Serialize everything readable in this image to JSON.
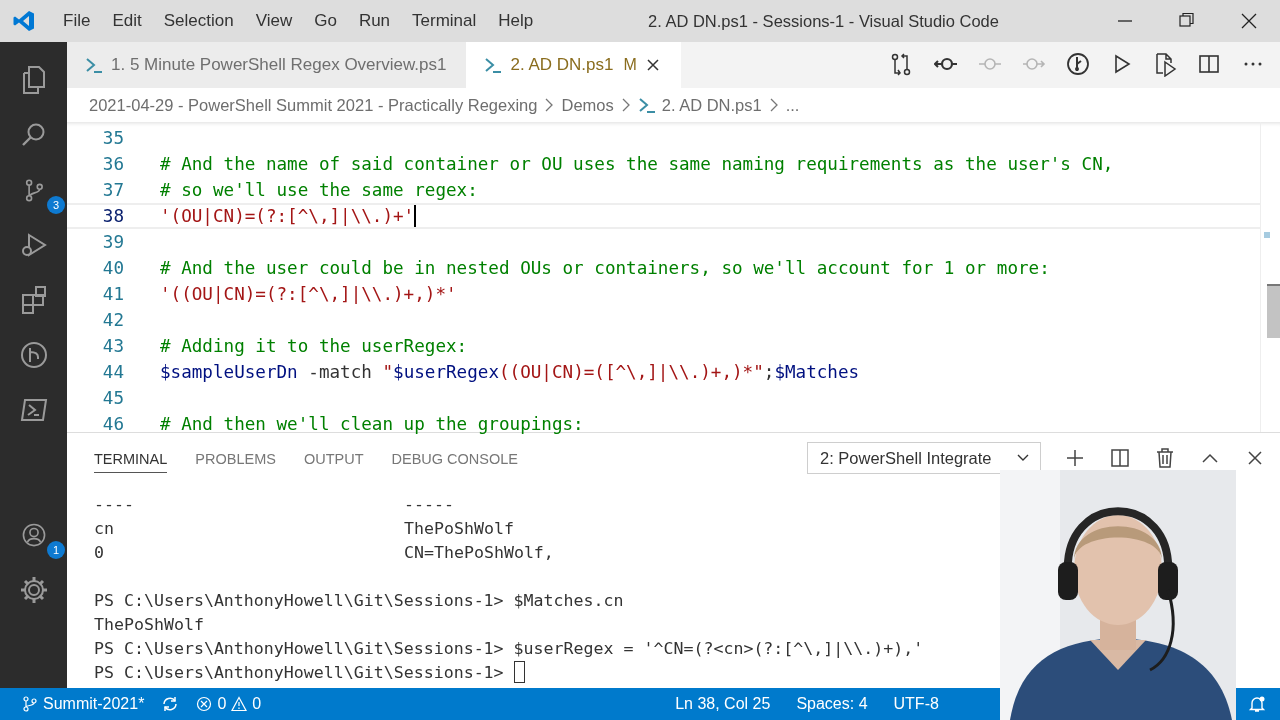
{
  "window": {
    "title": "2. AD DN.ps1 - Sessions-1 - Visual Studio Code"
  },
  "menu": [
    "File",
    "Edit",
    "Selection",
    "View",
    "Go",
    "Run",
    "Terminal",
    "Help"
  ],
  "activity_bar": [
    {
      "kind": "explorer"
    },
    {
      "kind": "search"
    },
    {
      "kind": "scm",
      "badge": "3"
    },
    {
      "kind": "debug"
    },
    {
      "kind": "extensions"
    },
    {
      "kind": "remote"
    },
    {
      "kind": "powershell"
    },
    {
      "kind": "account",
      "badge": "1"
    },
    {
      "kind": "settings"
    }
  ],
  "tabs": [
    {
      "label": "1. 5 Minute PowerShell Regex Overview.ps1",
      "selected": false,
      "modified": false
    },
    {
      "label": "2. AD DN.ps1",
      "selected": true,
      "modified": true,
      "mark": "M"
    }
  ],
  "editor_actions": [
    {
      "kind": "compare",
      "enabled": true
    },
    {
      "kind": "prev",
      "enabled": true
    },
    {
      "kind": "commit",
      "enabled": false
    },
    {
      "kind": "next",
      "enabled": false
    },
    {
      "kind": "timeline",
      "enabled": true
    },
    {
      "kind": "run",
      "enabled": true
    },
    {
      "kind": "runfile",
      "enabled": true
    },
    {
      "kind": "split",
      "enabled": true
    },
    {
      "kind": "more",
      "enabled": true
    }
  ],
  "breadcrumbs": [
    {
      "label": "2021-04-29 - PowerShell Summit 2021 - Practically Regexing"
    },
    {
      "label": "Demos"
    },
    {
      "label": "2. AD DN.ps1",
      "kind": "file"
    },
    {
      "label": "..."
    }
  ],
  "editor": {
    "lines": [
      {
        "number": "35"
      },
      {
        "number": "36",
        "tokens": [
          {
            "kind": "comment",
            "text": "# And the name of said container or OU uses the same naming requirements as the user's CN,"
          }
        ]
      },
      {
        "number": "37",
        "tokens": [
          {
            "kind": "comment",
            "text": "# so we'll use the same regex:"
          }
        ]
      },
      {
        "number": "38",
        "current": true,
        "tokens": [
          {
            "kind": "string",
            "text": "'(OU|CN)=(?:[^\\,]|\\\\.)+'"
          }
        ]
      },
      {
        "number": "39"
      },
      {
        "number": "40",
        "tokens": [
          {
            "kind": "comment",
            "text": "# And the user could be in nested OUs or containers, so we'll account for 1 or more:"
          }
        ]
      },
      {
        "number": "41",
        "tokens": [
          {
            "kind": "string",
            "text": "'((OU|CN)=(?:[^\\,]|\\\\.)+,)*'"
          }
        ]
      },
      {
        "number": "42"
      },
      {
        "number": "43",
        "tokens": [
          {
            "kind": "comment",
            "text": "# Adding it to the userRegex:"
          }
        ]
      },
      {
        "number": "44",
        "tokens": [
          {
            "kind": "variable",
            "text": "$sampleUserDn"
          },
          {
            "kind": "plain",
            "text": " -match "
          },
          {
            "kind": "string",
            "text": "\""
          },
          {
            "kind": "variable",
            "text": "$userRegex"
          },
          {
            "kind": "string",
            "text": "((OU|CN)=([^\\,]|\\\\.)+,)*\""
          },
          {
            "kind": "plain",
            "text": ";"
          },
          {
            "kind": "variable",
            "text": "$Matches"
          }
        ]
      },
      {
        "number": "45"
      },
      {
        "number": "46",
        "tokens": [
          {
            "kind": "comment",
            "text": "# And then we'll clean up the groupings:"
          }
        ]
      }
    ]
  },
  "panel": {
    "tabs": [
      {
        "label": "TERMINAL",
        "selected": true
      },
      {
        "label": "PROBLEMS",
        "selected": false
      },
      {
        "label": "OUTPUT",
        "selected": false
      },
      {
        "label": "DEBUG CONSOLE",
        "selected": false
      }
    ],
    "terminal_select": "2: PowerShell Integrate",
    "terminal_lines": [
      {
        "kind": "columns",
        "cells": [
          "----",
          "-----"
        ]
      },
      {
        "kind": "columns",
        "cells": [
          "cn",
          "ThePoShWolf"
        ]
      },
      {
        "kind": "columns",
        "cells": [
          "0",
          "CN=ThePoShWolf,"
        ]
      },
      {
        "kind": "blank"
      },
      {
        "kind": "prompt",
        "prompt": "PS C:\\Users\\AnthonyHowell\\Git\\Sessions-1>",
        "command": "$Matches.cn"
      },
      {
        "kind": "output",
        "text": "ThePoShWolf"
      },
      {
        "kind": "prompt",
        "prompt": "PS C:\\Users\\AnthonyHowell\\Git\\Sessions-1>",
        "command": "$userRegex = '^CN=(?<cn>(?:[^\\,]|\\\\.)+),'"
      },
      {
        "kind": "prompt",
        "prompt": "PS C:\\Users\\AnthonyHowell\\Git\\Sessions-1>",
        "cursor": true
      }
    ]
  },
  "status_bar": {
    "branch": "Summit-2021*",
    "errors": "0",
    "warnings": "0",
    "right": [
      "Ln 38, Col 25",
      "Spaces: 4",
      "UTF-8"
    ]
  }
}
